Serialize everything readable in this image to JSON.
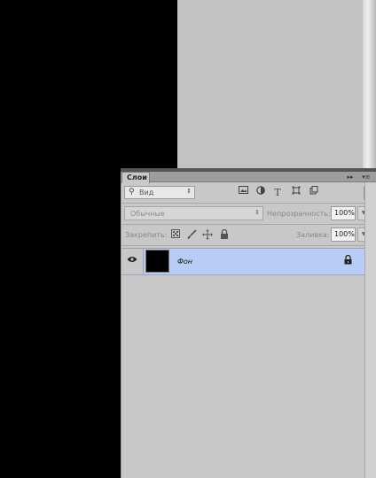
{
  "layers_panel": {
    "tab_label": "Слои",
    "tab_arrows": "▸▸",
    "tab_menu": "▾≡",
    "filter": {
      "search_icon": "⚲",
      "label": "Вид",
      "arrow": "⇕",
      "icons": [
        "image-icon",
        "adjustment-icon",
        "text-icon",
        "shape-icon",
        "smart-object-icon"
      ]
    },
    "blend_mode": {
      "value": "Обычные",
      "arrow": "⇕"
    },
    "opacity": {
      "label": "Непрозрачность:",
      "value": "100%"
    },
    "lock": {
      "label": "Закрепить:",
      "icons": [
        "lock-transparent-icon",
        "lock-brush-icon",
        "lock-move-icon",
        "lock-all-icon"
      ]
    },
    "fill": {
      "label": "Заливка:",
      "value": "100%"
    },
    "layers": [
      {
        "name": "Фон",
        "visible": true,
        "locked": true,
        "thumbnail_color": "#000000"
      }
    ]
  }
}
